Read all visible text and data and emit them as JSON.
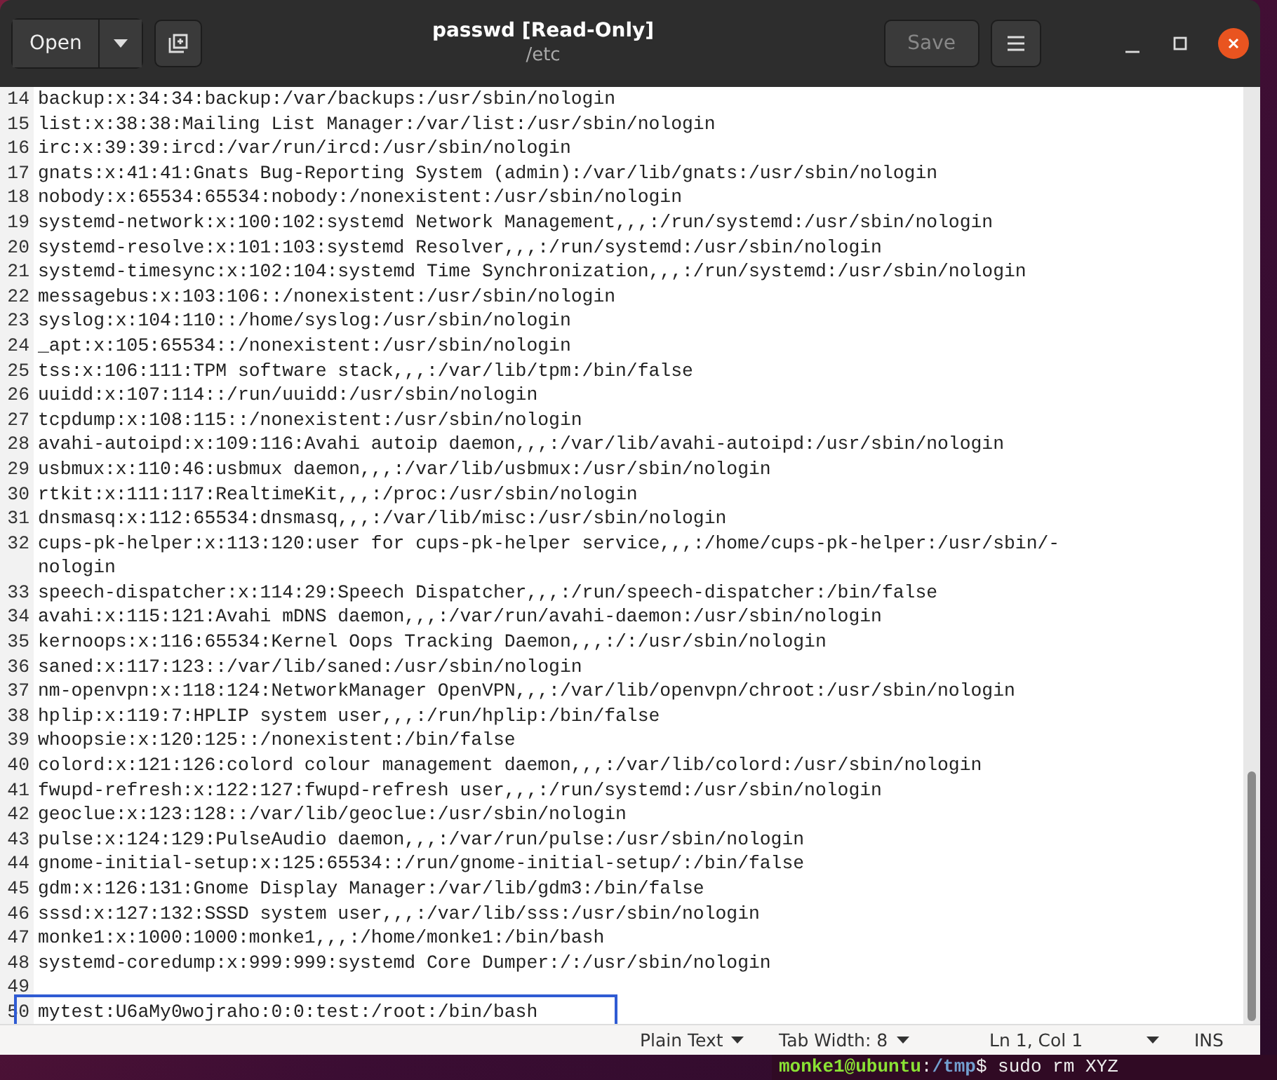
{
  "header": {
    "open_button": "Open",
    "title": "passwd [Read-Only]",
    "subtitle": "/etc",
    "save_button": {
      "label": "Save",
      "disabled": true
    }
  },
  "editor": {
    "lines": [
      {
        "number": "14",
        "text": "backup:x:34:34:backup:/var/backups:/usr/sbin/nologin",
        "highlighted": false
      },
      {
        "number": "15",
        "text": "list:x:38:38:Mailing List Manager:/var/list:/usr/sbin/nologin",
        "highlighted": false
      },
      {
        "number": "16",
        "text": "irc:x:39:39:ircd:/var/run/ircd:/usr/sbin/nologin",
        "highlighted": false
      },
      {
        "number": "17",
        "text": "gnats:x:41:41:Gnats Bug-Reporting System (admin):/var/lib/gnats:/usr/sbin/nologin",
        "highlighted": false
      },
      {
        "number": "18",
        "text": "nobody:x:65534:65534:nobody:/nonexistent:/usr/sbin/nologin",
        "highlighted": false
      },
      {
        "number": "19",
        "text": "systemd-network:x:100:102:systemd Network Management,,,:/run/systemd:/usr/sbin/nologin",
        "highlighted": false
      },
      {
        "number": "20",
        "text": "systemd-resolve:x:101:103:systemd Resolver,,,:/run/systemd:/usr/sbin/nologin",
        "highlighted": false
      },
      {
        "number": "21",
        "text": "systemd-timesync:x:102:104:systemd Time Synchronization,,,:/run/systemd:/usr/sbin/nologin",
        "highlighted": false
      },
      {
        "number": "22",
        "text": "messagebus:x:103:106::/nonexistent:/usr/sbin/nologin",
        "highlighted": false
      },
      {
        "number": "23",
        "text": "syslog:x:104:110::/home/syslog:/usr/sbin/nologin",
        "highlighted": false
      },
      {
        "number": "24",
        "text": "_apt:x:105:65534::/nonexistent:/usr/sbin/nologin",
        "highlighted": false
      },
      {
        "number": "25",
        "text": "tss:x:106:111:TPM software stack,,,:/var/lib/tpm:/bin/false",
        "highlighted": false
      },
      {
        "number": "26",
        "text": "uuidd:x:107:114::/run/uuidd:/usr/sbin/nologin",
        "highlighted": false
      },
      {
        "number": "27",
        "text": "tcpdump:x:108:115::/nonexistent:/usr/sbin/nologin",
        "highlighted": false
      },
      {
        "number": "28",
        "text": "avahi-autoipd:x:109:116:Avahi autoip daemon,,,:/var/lib/avahi-autoipd:/usr/sbin/nologin",
        "highlighted": false
      },
      {
        "number": "29",
        "text": "usbmux:x:110:46:usbmux daemon,,,:/var/lib/usbmux:/usr/sbin/nologin",
        "highlighted": false
      },
      {
        "number": "30",
        "text": "rtkit:x:111:117:RealtimeKit,,,:/proc:/usr/sbin/nologin",
        "highlighted": false
      },
      {
        "number": "31",
        "text": "dnsmasq:x:112:65534:dnsmasq,,,:/var/lib/misc:/usr/sbin/nologin",
        "highlighted": false
      },
      {
        "number": "32",
        "text": "cups-pk-helper:x:113:120:user for cups-pk-helper service,,,:/home/cups-pk-helper:/usr/sbin/-",
        "continuation": "nologin",
        "highlighted": false
      },
      {
        "number": "33",
        "text": "speech-dispatcher:x:114:29:Speech Dispatcher,,,:/run/speech-dispatcher:/bin/false",
        "highlighted": false
      },
      {
        "number": "34",
        "text": "avahi:x:115:121:Avahi mDNS daemon,,,:/var/run/avahi-daemon:/usr/sbin/nologin",
        "highlighted": false
      },
      {
        "number": "35",
        "text": "kernoops:x:116:65534:Kernel Oops Tracking Daemon,,,:/:/usr/sbin/nologin",
        "highlighted": false
      },
      {
        "number": "36",
        "text": "saned:x:117:123::/var/lib/saned:/usr/sbin/nologin",
        "highlighted": false
      },
      {
        "number": "37",
        "text": "nm-openvpn:x:118:124:NetworkManager OpenVPN,,,:/var/lib/openvpn/chroot:/usr/sbin/nologin",
        "highlighted": false
      },
      {
        "number": "38",
        "text": "hplip:x:119:7:HPLIP system user,,,:/run/hplip:/bin/false",
        "highlighted": false
      },
      {
        "number": "39",
        "text": "whoopsie:x:120:125::/nonexistent:/bin/false",
        "highlighted": false
      },
      {
        "number": "40",
        "text": "colord:x:121:126:colord colour management daemon,,,:/var/lib/colord:/usr/sbin/nologin",
        "highlighted": false
      },
      {
        "number": "41",
        "text": "fwupd-refresh:x:122:127:fwupd-refresh user,,,:/run/systemd:/usr/sbin/nologin",
        "highlighted": false
      },
      {
        "number": "42",
        "text": "geoclue:x:123:128::/var/lib/geoclue:/usr/sbin/nologin",
        "highlighted": false
      },
      {
        "number": "43",
        "text": "pulse:x:124:129:PulseAudio daemon,,,:/var/run/pulse:/usr/sbin/nologin",
        "highlighted": false
      },
      {
        "number": "44",
        "text": "gnome-initial-setup:x:125:65534::/run/gnome-initial-setup/:/bin/false",
        "highlighted": false
      },
      {
        "number": "45",
        "text": "gdm:x:126:131:Gnome Display Manager:/var/lib/gdm3:/bin/false",
        "highlighted": false
      },
      {
        "number": "46",
        "text": "sssd:x:127:132:SSSD system user,,,:/var/lib/sss:/usr/sbin/nologin",
        "highlighted": false
      },
      {
        "number": "47",
        "text": "monke1:x:1000:1000:monke1,,,:/home/monke1:/bin/bash",
        "highlighted": false
      },
      {
        "number": "48",
        "text": "systemd-coredump:x:999:999:systemd Core Dumper:/:/usr/sbin/nologin",
        "highlighted": false
      },
      {
        "number": "49",
        "highlighted": false
      },
      {
        "number": "50",
        "text": "mytest:U6aMy0wojraho:0:0:test:/root:/bin/bash",
        "highlighted": true
      }
    ]
  },
  "status_bar": {
    "language": "Plain Text",
    "tab_width": "Tab Width: 8",
    "position": "Ln 1, Col 1",
    "mode": "INS"
  },
  "terminal": {
    "user_host": "monke1@ubuntu",
    "colon": ":",
    "path": "/tmp",
    "command": "$ sudo rm XYZ"
  }
}
